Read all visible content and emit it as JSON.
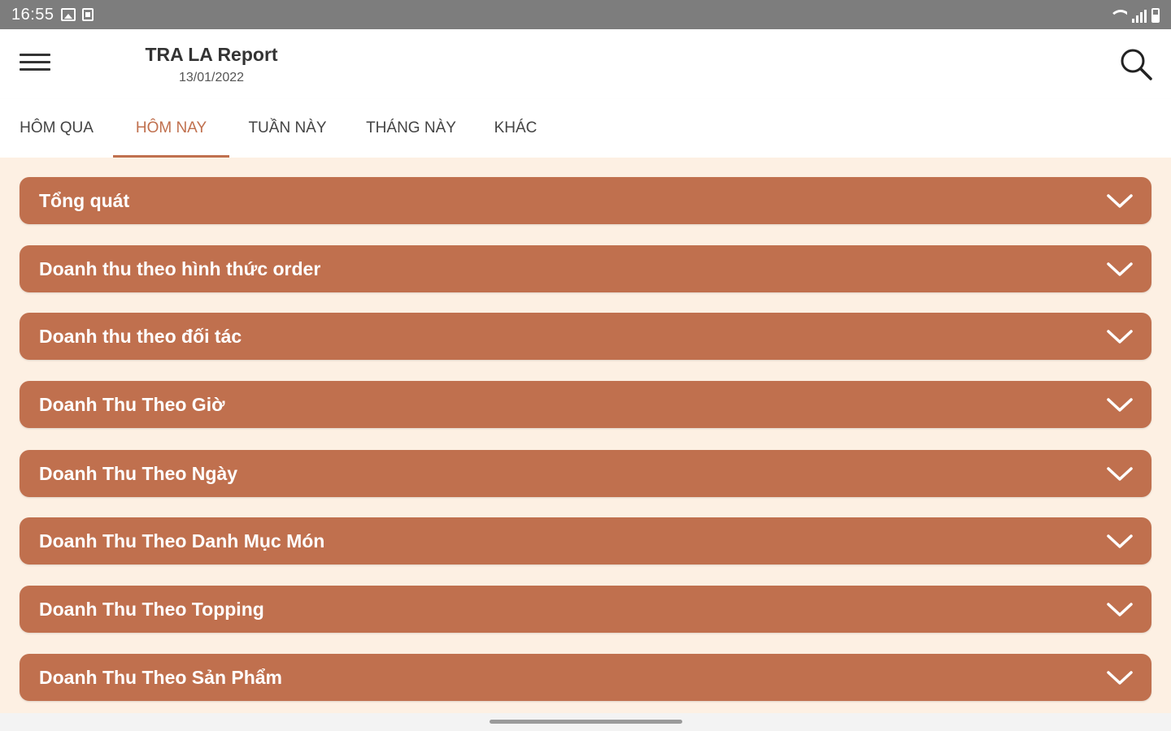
{
  "status_bar": {
    "time": "16:55",
    "left_icons": [
      "image-icon",
      "screenshot-icon"
    ],
    "right_icons": [
      "wifi-icon",
      "signal-icon",
      "battery-icon"
    ]
  },
  "header": {
    "title": "TRA LA Report",
    "date": "13/01/2022",
    "menu_icon": "menu-icon",
    "search_icon": "search-icon"
  },
  "tabs": [
    {
      "label": "HÔM QUA",
      "active": false
    },
    {
      "label": "HÔM NAY",
      "active": true
    },
    {
      "label": "TUẦN NÀY",
      "active": false
    },
    {
      "label": "THÁNG NÀY",
      "active": false
    },
    {
      "label": "KHÁC",
      "active": false
    }
  ],
  "sections": [
    {
      "title": "Tổng quát"
    },
    {
      "title": "Doanh thu theo hình thức order"
    },
    {
      "title": "Doanh thu theo đối tác"
    },
    {
      "title": "Doanh Thu Theo Giờ"
    },
    {
      "title": "Doanh Thu Theo Ngày"
    },
    {
      "title": "Doanh Thu Theo Danh Mục Món"
    },
    {
      "title": "Doanh Thu Theo Topping"
    },
    {
      "title": "Doanh Thu Theo Sản Phẩm"
    }
  ],
  "colors": {
    "accent": "#c0704e",
    "background": "#fdf0e3",
    "status_bar": "#7d7d7d"
  }
}
